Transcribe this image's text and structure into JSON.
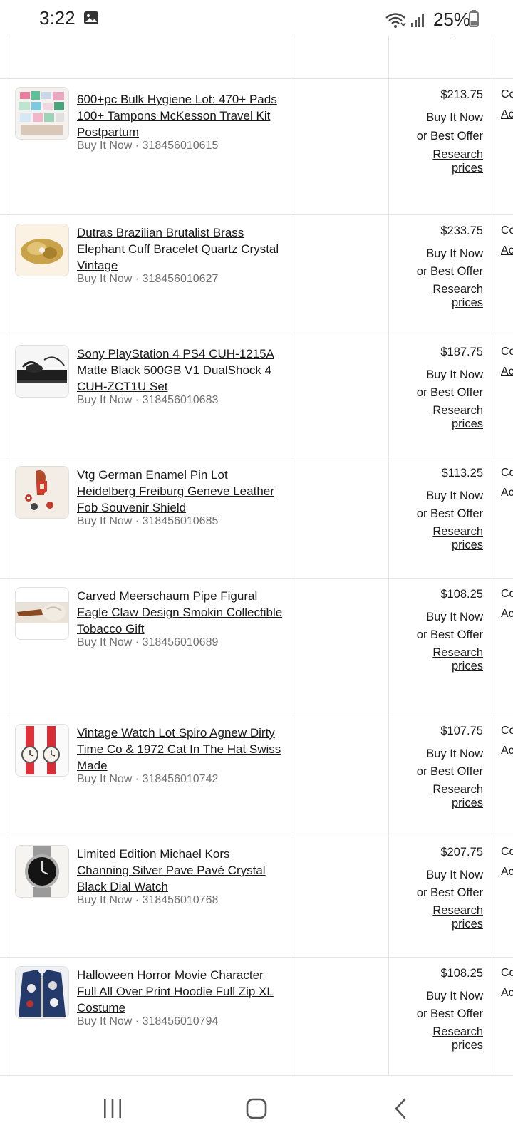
{
  "status": {
    "time": "3:22",
    "battery": "25%"
  },
  "top_partial": {
    "research_tail": "prices"
  },
  "rows": [
    {
      "title": "600+pc Bulk Hygiene Lot: 470+ Pads 100+ Tampons McKesson Travel Kit Postpartum",
      "meta": "Buy It Now · 318456010615",
      "price": "$213.75",
      "bin": "Buy It Now",
      "bo": "or Best Offer",
      "research": "Research prices",
      "cut_top": "Co",
      "cut_link": "Ac dis"
    },
    {
      "title": "Dutras Brazilian Brutalist Brass Elephant Cuff Bracelet Quartz Crystal Vintage",
      "meta": "Buy It Now · 318456010627",
      "price": "$233.75",
      "bin": "Buy It Now",
      "bo": "or Best Offer",
      "research": "Research prices",
      "cut_top": "Co",
      "cut_link": "Ac dis"
    },
    {
      "title": "Sony PlayStation 4 PS4 CUH-1215A Matte Black 500GB V1 DualShock 4 CUH-ZCT1U Set",
      "meta": "Buy It Now · 318456010683",
      "price": "$187.75",
      "bin": "Buy It Now",
      "bo": "or Best Offer",
      "research": "Research prices",
      "cut_top": "Co",
      "cut_link": "Ac dis"
    },
    {
      "title": "Vtg German Enamel Pin Lot Heidelberg Freiburg Geneve Leather Fob Souvenir Shield",
      "meta": "Buy It Now · 318456010685",
      "price": "$113.25",
      "bin": "Buy It Now",
      "bo": "or Best Offer",
      "research": "Research prices",
      "cut_top": "Co",
      "cut_link": "Ac dis"
    },
    {
      "title": "Carved Meerschaum Pipe Figural Eagle Claw Design Smokin Collectible Tobacco Gift",
      "meta": "Buy It Now · 318456010689",
      "price": "$108.25",
      "bin": "Buy It Now",
      "bo": "or Best Offer",
      "research": "Research prices",
      "cut_top": "Co",
      "cut_link": "Ac dis"
    },
    {
      "title": "Vintage Watch Lot Spiro Agnew Dirty Time Co & 1972 Cat In The Hat Swiss Made",
      "meta": "Buy It Now · 318456010742",
      "price": "$107.75",
      "bin": "Buy It Now",
      "bo": "or Best Offer",
      "research": "Research prices",
      "cut_top": "Co",
      "cut_link": "Ac dis"
    },
    {
      "title": "Limited Edition Michael Kors Channing Silver Pave Pavé Crystal Black Dial Watch",
      "meta": "Buy It Now · 318456010768",
      "price": "$207.75",
      "bin": "Buy It Now",
      "bo": "or Best Offer",
      "research": "Research prices",
      "cut_top": "Co",
      "cut_link": "Ac dis"
    },
    {
      "title": "Halloween Horror Movie Character Full All Over Print Hoodie Full Zip XL Costume",
      "meta": "Buy It Now · 318456010794",
      "price": "$108.25",
      "bin": "Buy It Now",
      "bo": "or Best Offer",
      "research": "Research prices",
      "cut_top": "Co",
      "cut_link": "Ac dis"
    }
  ],
  "icons": {
    "status": [
      "image-icon",
      "wifi-icon",
      "signal-icon",
      "battery-icon"
    ],
    "nav": [
      "recents-icon",
      "home-icon",
      "back-icon"
    ]
  }
}
